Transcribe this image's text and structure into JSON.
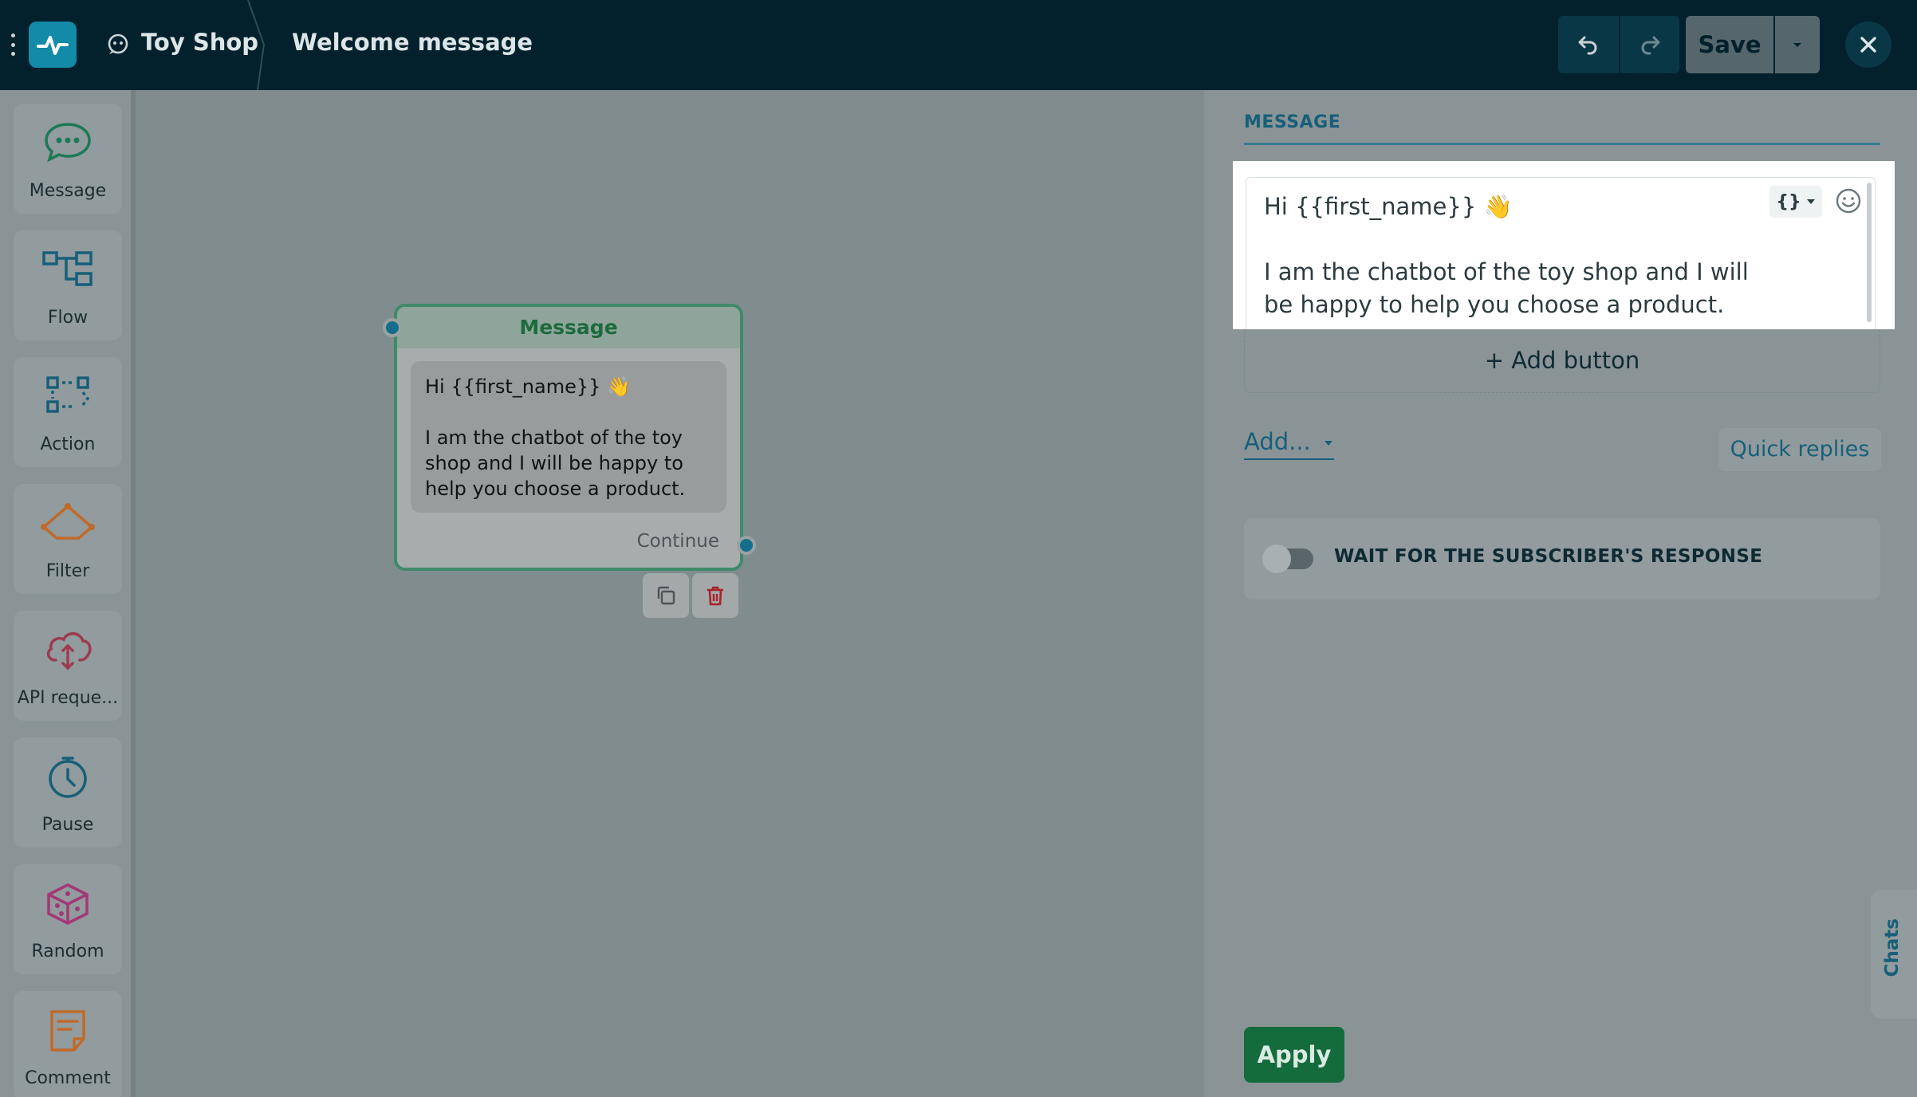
{
  "topbar": {
    "bot_name": "Toy Shop",
    "flow_name": "Welcome message",
    "save_label": "Save"
  },
  "rail": {
    "items": [
      {
        "label": "Message",
        "icon": "message-bubble-icon",
        "color": "#1b7a55"
      },
      {
        "label": "Flow",
        "icon": "flow-icon",
        "color": "#175f7a"
      },
      {
        "label": "Action",
        "icon": "action-icon",
        "color": "#175f7a"
      },
      {
        "label": "Filter",
        "icon": "filter-icon",
        "color": "#c06a2a"
      },
      {
        "label": "API reque...",
        "icon": "api-cloud-icon",
        "color": "#9e3a4f"
      },
      {
        "label": "Pause",
        "icon": "clock-icon",
        "color": "#175f7a"
      },
      {
        "label": "Random",
        "icon": "dice-icon",
        "color": "#a33876"
      },
      {
        "label": "Comment",
        "icon": "comment-note-icon",
        "color": "#c06a2a"
      }
    ]
  },
  "node": {
    "title": "Message",
    "greeting": "Hi {{first_name}} 👋",
    "body": "I am the chatbot of the toy shop and I will be happy to help you choose a product.",
    "continue_label": "Continue"
  },
  "panel": {
    "section_title": "MESSAGE",
    "editor_greeting": "Hi {{first_name}} 👋",
    "editor_body": "I am the chatbot of the toy shop and I will be happy to help you choose a product.",
    "variable_btn": "{}",
    "add_button_label": "+ Add button",
    "add_more_label": "Add...",
    "quick_replies_label": "Quick replies",
    "wait_label": "WAIT FOR THE SUBSCRIBER'S RESPONSE",
    "wait_enabled": false,
    "chats_tab": "Chats",
    "apply_label": "Apply"
  },
  "colors": {
    "topbar": "#02212d",
    "accent": "#175f7a",
    "apply": "#146b3c",
    "node_border": "#3f8a6b"
  }
}
